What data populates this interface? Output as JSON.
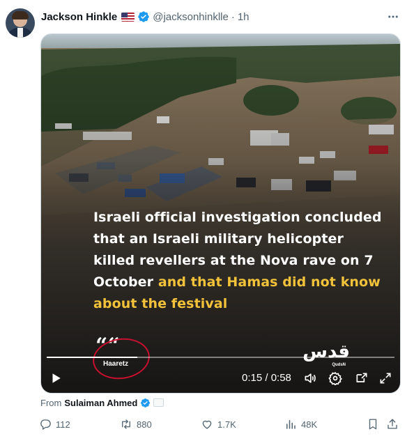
{
  "author": {
    "name": "Jackson Hinkle",
    "handle": "@jacksonhinklle",
    "separator": "·",
    "time": "1h"
  },
  "media": {
    "caption_white": "Israeli official investigation concluded that an Israeli military helicopter killed revellers at the Nova rave on 7 October",
    "caption_highlight": "and that Hamas did not know about the festival",
    "quote_mark": "““",
    "source_label": "Haaretz",
    "brand": "قدس",
    "brand_handle": "QudsN",
    "progress_fraction": 0.26,
    "timecode": "0:15 / 0:58"
  },
  "from": {
    "prefix": "From",
    "name": "Sulaiman Ahmed"
  },
  "actions": {
    "replies": "112",
    "reposts": "880",
    "likes": "1.7K",
    "views": "48K"
  },
  "colors": {
    "verified_blue": "#1d9bf0",
    "highlight_yellow": "#f2c23a",
    "muted_text": "#536471",
    "circle_red": "#c8102e"
  },
  "icons": [
    "more-icon",
    "verified-icon",
    "play-icon",
    "volume-icon",
    "settings-icon",
    "picture-in-picture-icon",
    "fullscreen-icon",
    "reply-icon",
    "repost-icon",
    "like-icon",
    "views-icon",
    "bookmark-icon",
    "share-icon"
  ]
}
